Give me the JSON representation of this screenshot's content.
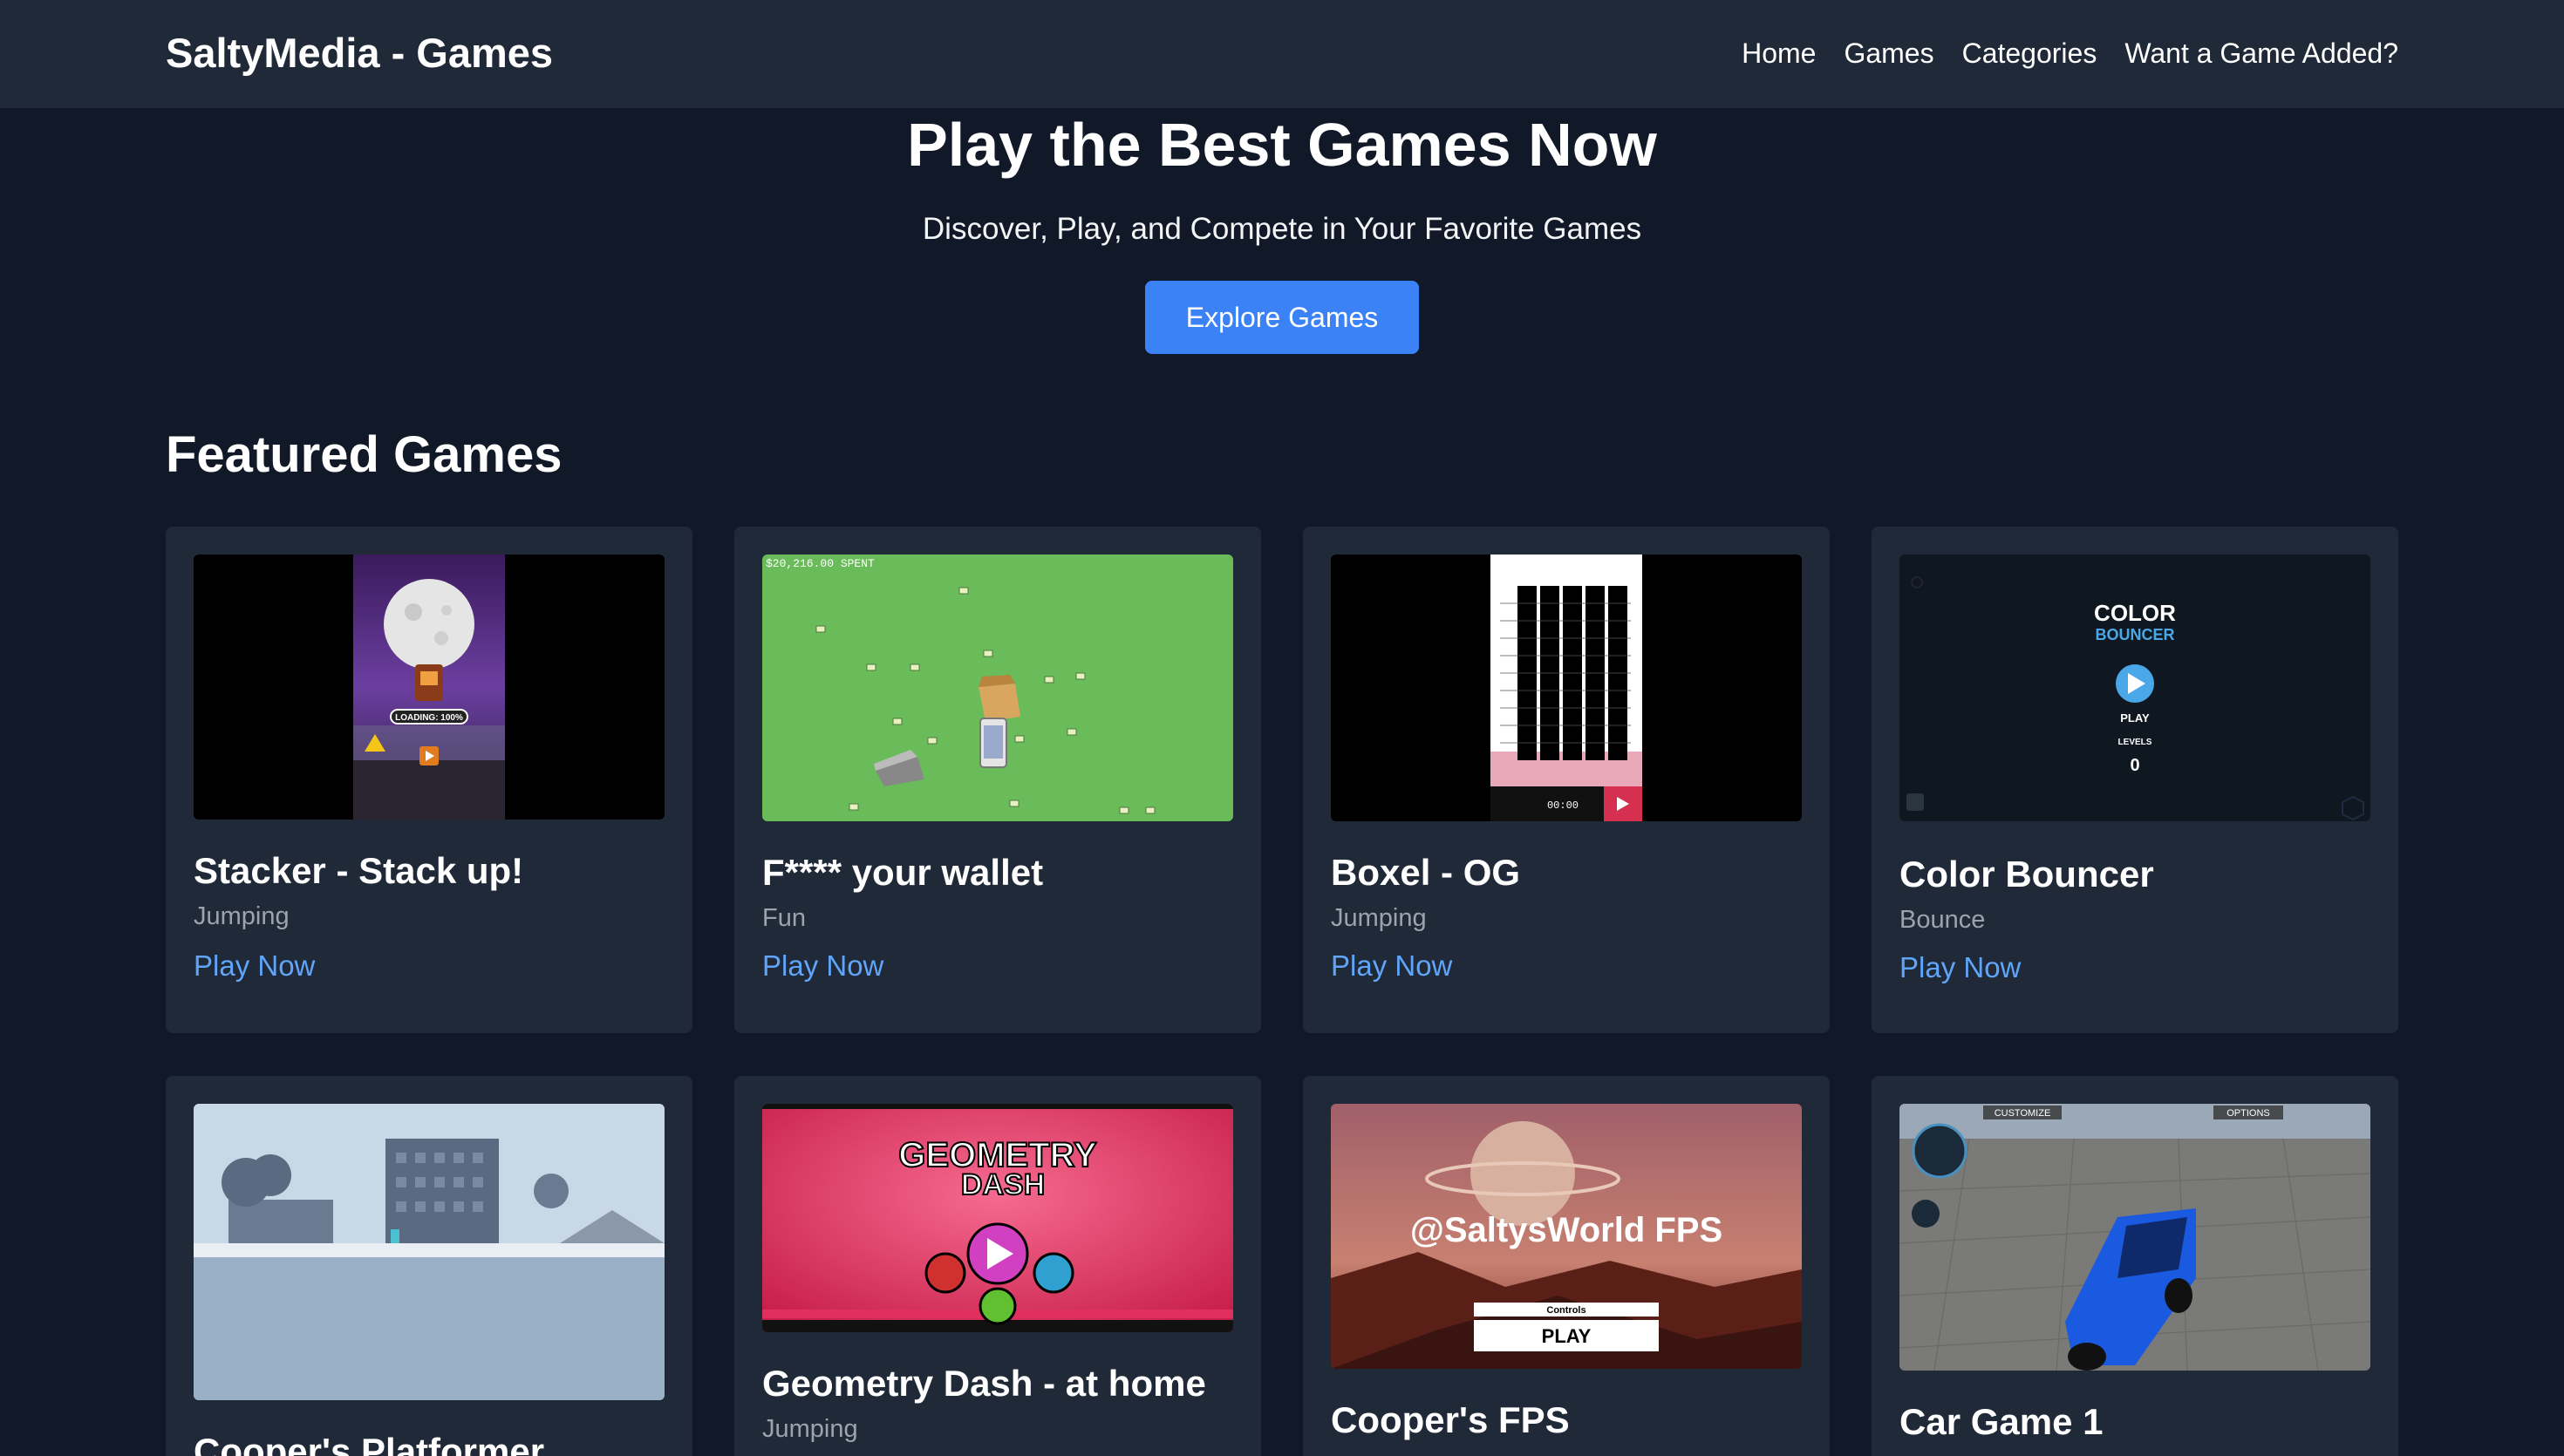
{
  "nav": {
    "brand": "SaltyMedia - Games",
    "links": [
      "Home",
      "Games",
      "Categories",
      "Want a Game Added?"
    ]
  },
  "hero": {
    "title": "Play the Best Games Now",
    "subtitle": "Discover, Play, and Compete in Your Favorite Games",
    "cta": "Explore Games"
  },
  "featured": {
    "title": "Featured Games",
    "play_label": "Play Now",
    "games": [
      {
        "title": "Stacker - Stack up!",
        "category": "Jumping",
        "thumb_text": "LOADING: 100%"
      },
      {
        "title": "F**** your wallet",
        "category": "Fun",
        "thumb_text": "$20,216.00 SPENT"
      },
      {
        "title": "Boxel - OG",
        "category": "Jumping",
        "thumb_text": "00:00"
      },
      {
        "title": "Color Bouncer",
        "category": "Bounce",
        "thumb_text": [
          "COLOR",
          "BOUNCER",
          "PLAY",
          "LEVELS",
          "0"
        ]
      },
      {
        "title": "Cooper's Platformer",
        "category": ""
      },
      {
        "title": "Geometry Dash - at home",
        "category": "Jumping",
        "thumb_text": [
          "GEOMETRY",
          "DASH"
        ]
      },
      {
        "title": "Cooper's FPS",
        "category": "",
        "thumb_text": [
          "@SaltysWorld FPS",
          "Controls",
          "PLAY"
        ]
      },
      {
        "title": "Car Game 1",
        "category": "",
        "thumb_text": [
          "CUSTOMIZE",
          "OPTIONS"
        ]
      }
    ]
  }
}
